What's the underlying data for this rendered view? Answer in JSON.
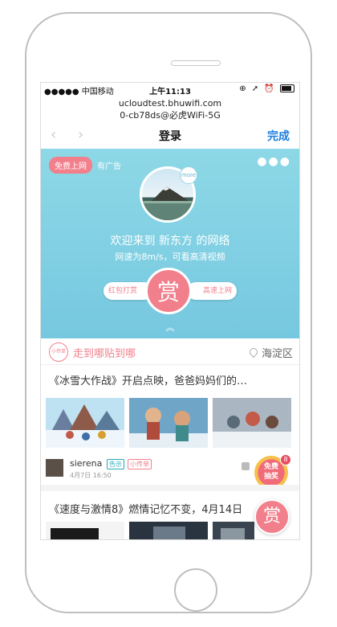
{
  "status": {
    "carrier": "●●●●● 中国移动",
    "time": "上午11:13",
    "right_icons": "⊕ ➚ ⏰"
  },
  "url": {
    "line1": "ucloudtest.bhuwifi.com",
    "line2": "0-cb78ds@必虎WiFi-5G"
  },
  "nav": {
    "back": "‹",
    "forward": "›",
    "title": "登录",
    "done": "完成"
  },
  "hero": {
    "free_tag": "免费上网",
    "ad_text": "有广告",
    "more_dots": "●●●",
    "more_badge": "more",
    "welcome": "欢迎来到 新东方 的网络",
    "speed": "网速为8m/s，可看高清视频",
    "left_pill": "红包打赏",
    "reward_char": "赏",
    "right_pill": "高速上网",
    "chevron": "︽"
  },
  "location": {
    "stamp": "小传单",
    "slogan": "走到哪贴到哪",
    "place": "海淀区"
  },
  "articles": [
    {
      "title": "《冰雪大作战》开启点映，爸爸妈妈们的…",
      "user": "sierena",
      "tag1": "告示",
      "tag2": "小传单",
      "date": "4月7日 16:50"
    },
    {
      "title": "《速度与激情8》燃情记忆不变，4月14日"
    }
  ],
  "lottery": {
    "label_line1": "免费",
    "label_line2": "抽奖",
    "count": "8"
  },
  "float_reward": "赏",
  "colors": {
    "accent_pink": "#f27f8c",
    "hero_blue": "#7fcfe3",
    "link_blue": "#1a7ee0"
  }
}
